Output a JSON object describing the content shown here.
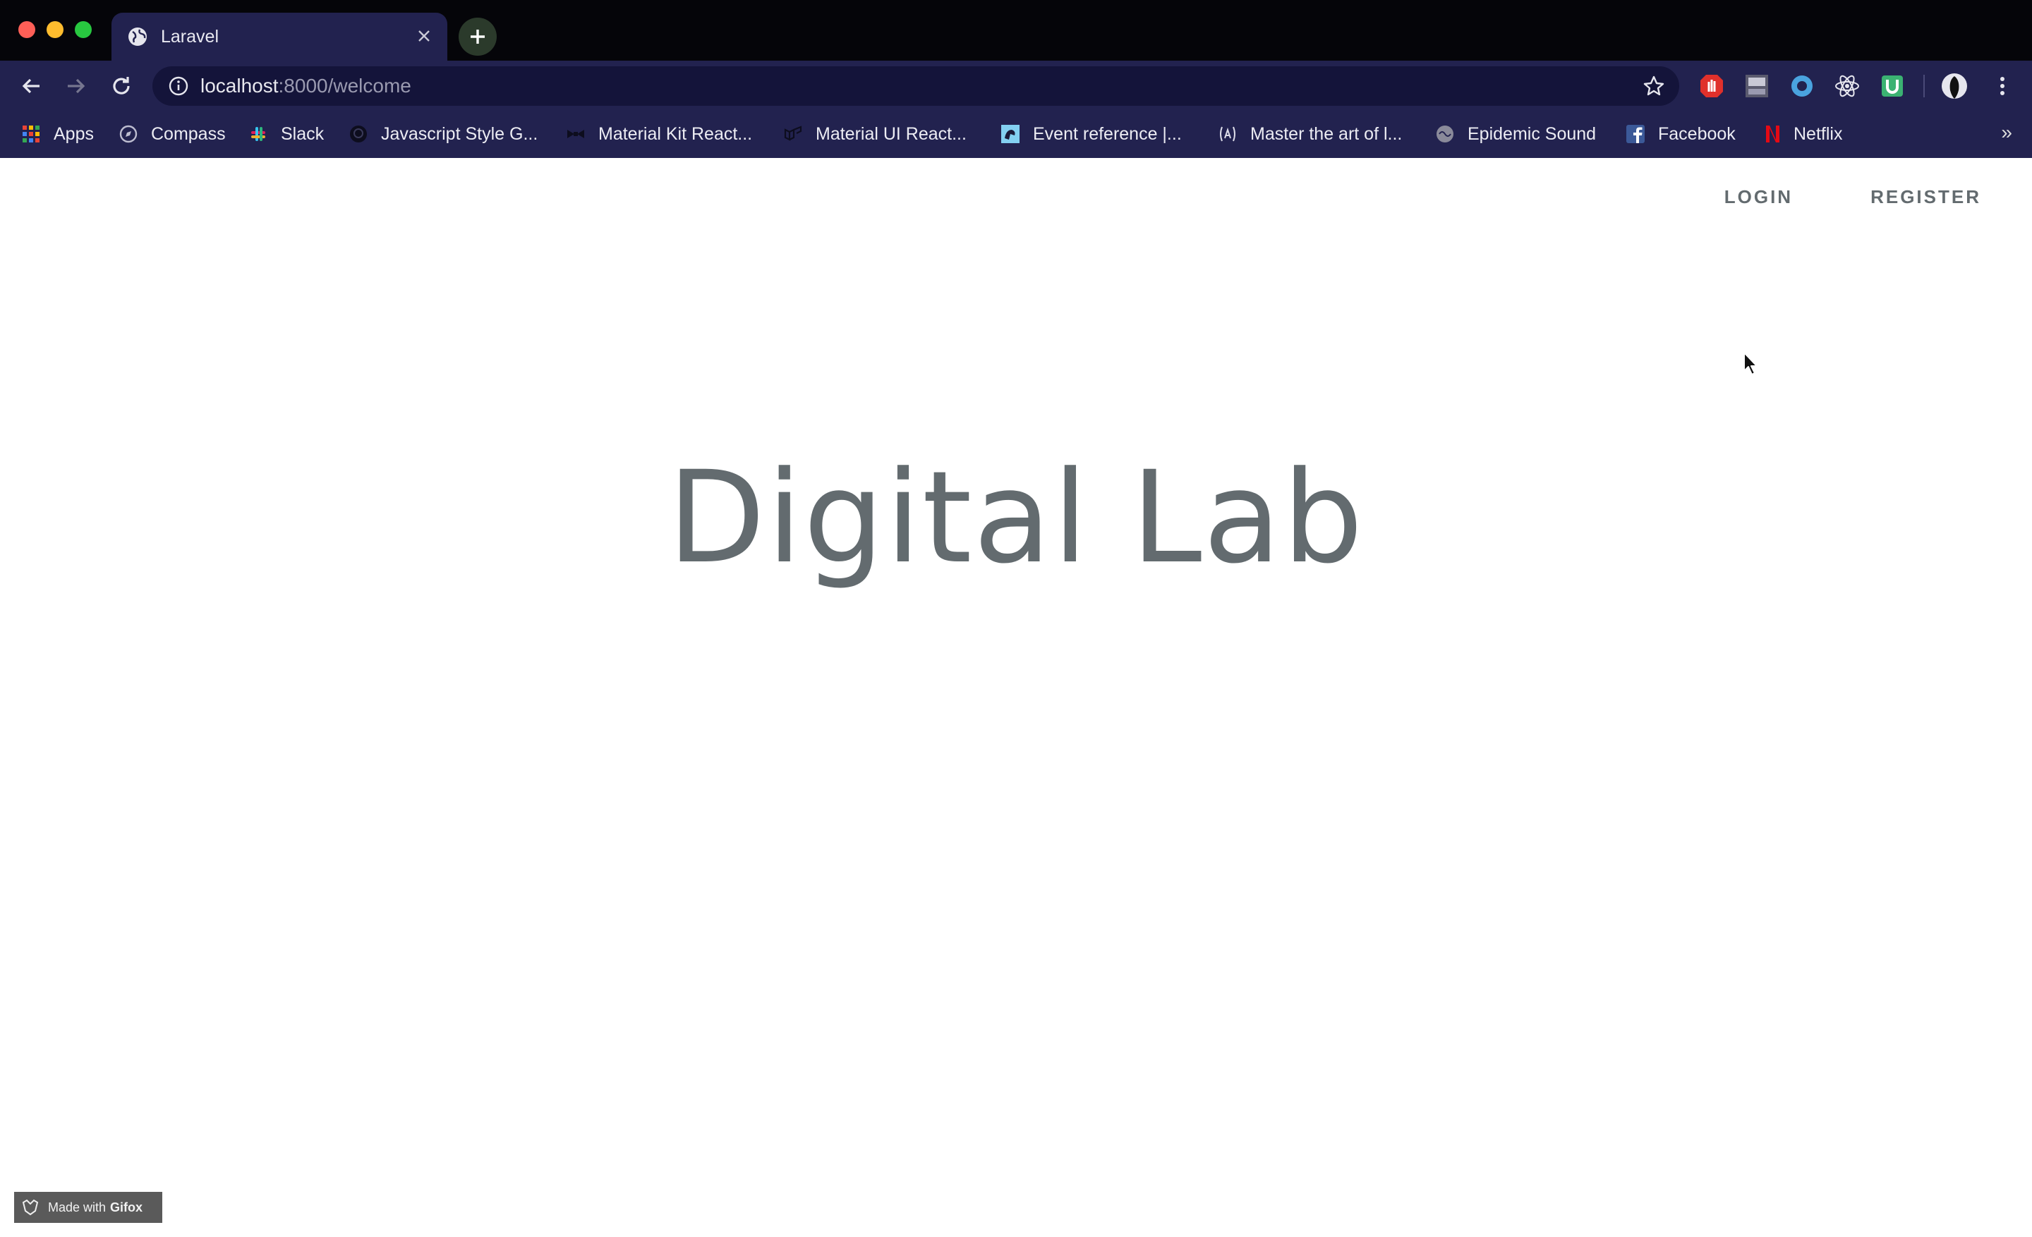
{
  "browser": {
    "tab": {
      "title": "Laravel"
    },
    "address": {
      "host": "localhost",
      "rest": ":8000/welcome"
    },
    "bookmarks": [
      {
        "label": "Apps",
        "icon": "apps-grid-icon"
      },
      {
        "label": "Compass",
        "icon": "compass-icon"
      },
      {
        "label": "Slack",
        "icon": "slack-icon"
      },
      {
        "label": "Javascript Style G...",
        "icon": "github-icon"
      },
      {
        "label": "Material Kit React...",
        "icon": "bowtie-icon"
      },
      {
        "label": "Material UI React...",
        "icon": "material-ui-icon"
      },
      {
        "label": "Event reference |...",
        "icon": "mdn-icon"
      },
      {
        "label": "Master the art of l...",
        "icon": "algolia-icon"
      },
      {
        "label": "Epidemic Sound",
        "icon": "epidemic-sound-icon"
      },
      {
        "label": "Facebook",
        "icon": "facebook-icon"
      },
      {
        "label": "Netflix",
        "icon": "netflix-icon"
      }
    ],
    "more": "»"
  },
  "page": {
    "nav": {
      "login": "LOGIN",
      "register": "REGISTER"
    },
    "title": "Digital Lab"
  },
  "badge": {
    "prefix": "Made with",
    "brand": "Gifox"
  },
  "colors": {
    "chrome": "#22224f",
    "tabstrip": "#050509",
    "page_text": "#636b6f"
  }
}
